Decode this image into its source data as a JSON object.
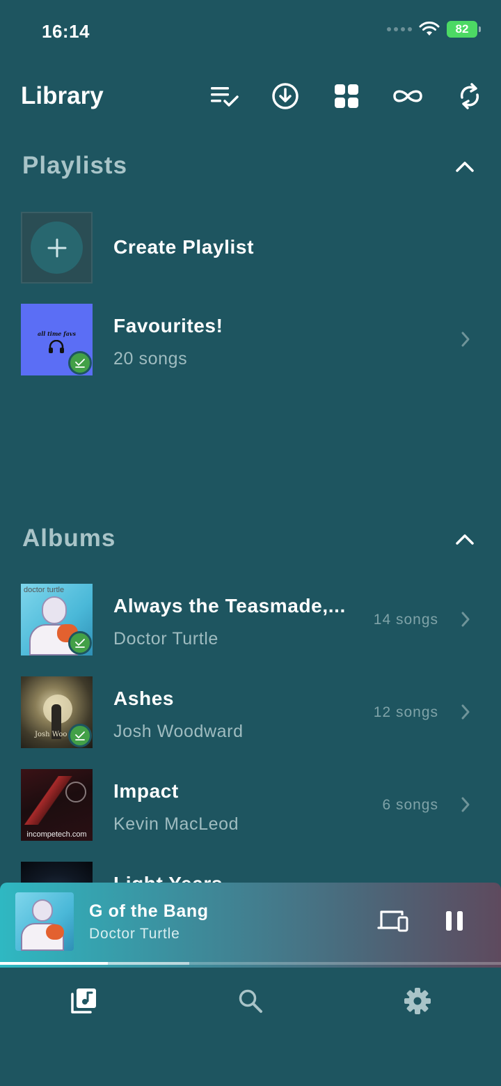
{
  "status_bar": {
    "time": "16:14",
    "battery": "82"
  },
  "header": {
    "title": "Library",
    "icons": [
      "playlist-check-icon",
      "download-circle-icon",
      "grid-icon",
      "infinity-icon",
      "sync-icon"
    ]
  },
  "playlists": {
    "title": "Playlists",
    "create_label": "Create Playlist",
    "items": [
      {
        "title": "Favourites!",
        "subtitle": "20 songs",
        "art_caption": "all time favs",
        "downloaded": true
      }
    ]
  },
  "albums": {
    "title": "Albums",
    "items": [
      {
        "title": "Always the Teasmade,...",
        "artist": "Doctor Turtle",
        "count": "14 songs",
        "art_caption": "doctor turtle",
        "downloaded": true
      },
      {
        "title": "Ashes",
        "artist": "Josh Woodward",
        "count": "12 songs",
        "art_caption": "Josh Woo",
        "downloaded": true
      },
      {
        "title": "Impact",
        "artist": "Kevin MacLeod",
        "count": "6 songs",
        "art_caption": "incompetech.com",
        "downloaded": false
      },
      {
        "title": "Light Years",
        "artist": "",
        "count": "",
        "art_caption": "",
        "downloaded": false
      }
    ]
  },
  "now_playing": {
    "title": "G of the Bang",
    "artist": "Doctor Turtle",
    "progress": 0.215,
    "buffered": 0.378
  },
  "bottom_nav": {
    "items": [
      "library-icon",
      "search-icon",
      "settings-icon"
    ],
    "active": "library-icon"
  },
  "colors": {
    "background": "#1e5560",
    "secondary_text": "#9fbcc0",
    "section_title": "#a9c4c8",
    "downloaded_badge": "#43a047",
    "playlist_art": "#5b6ef5"
  }
}
